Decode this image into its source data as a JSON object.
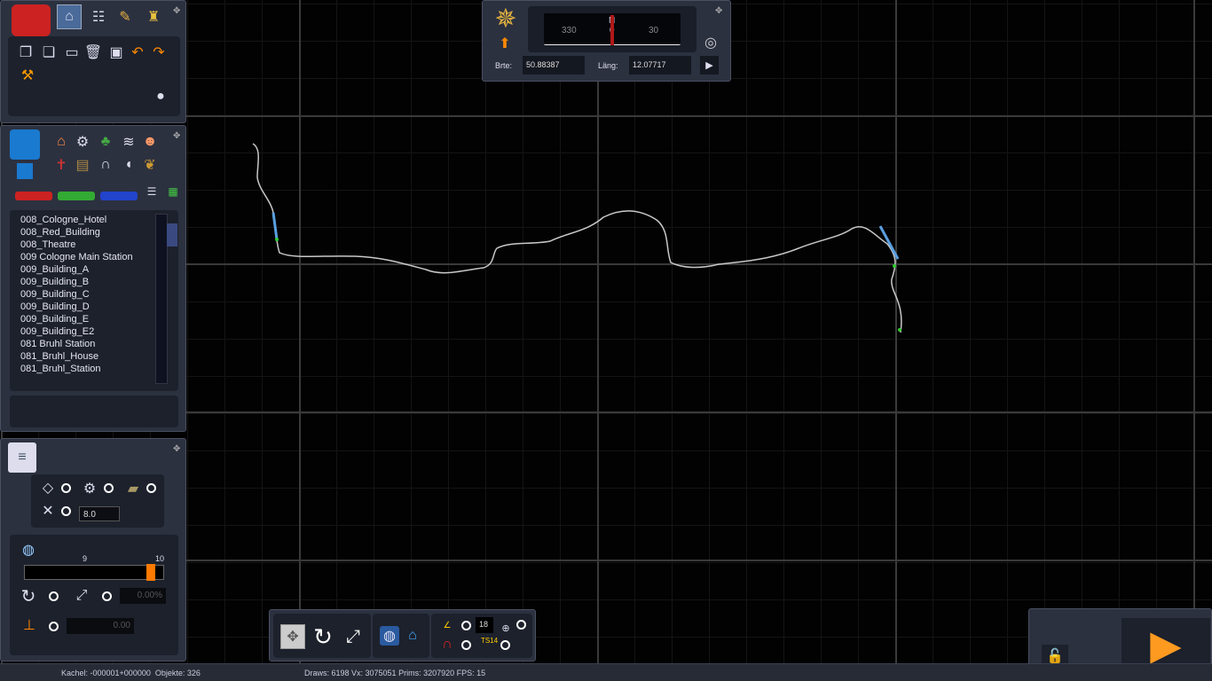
{
  "compass": {
    "heading_labels": [
      "330",
      "N",
      "0",
      "30"
    ],
    "lat_label": "Brte:",
    "lat_value": "50.88387",
    "lon_label": "Läng:",
    "lon_value": "12.07717"
  },
  "objects": {
    "items": [
      "008_Cologne_Hotel",
      "008_Red_Building",
      "008_Theatre",
      "009 Cologne Main Station",
      "009_Building_A",
      "009_Building_B",
      "009_Building_C",
      "009_Building_D",
      "009_Building_E",
      "009_Building_E2",
      "081 Bruhl Station",
      "081_Bruhl_House",
      "081_Bruhl_Station"
    ]
  },
  "properties": {
    "spacing_value": "8.0",
    "slider_min_label": "9",
    "slider_max_label": "10",
    "slider_value_fraction": 0.94,
    "percent_value": "0.00%",
    "height_value": "0.00"
  },
  "bottombar": {
    "number_value": "18",
    "ts_label": "TS14"
  },
  "status": {
    "left": "Kachel: -000001+000000  Objekte: 326",
    "right": "Draws: 6198 Vx: 3075051 Prims: 3207920 FPS: 15"
  },
  "colors": {
    "accent": "#ff7a00",
    "track": "#c8c8c8",
    "water": "#5a9fe0"
  }
}
